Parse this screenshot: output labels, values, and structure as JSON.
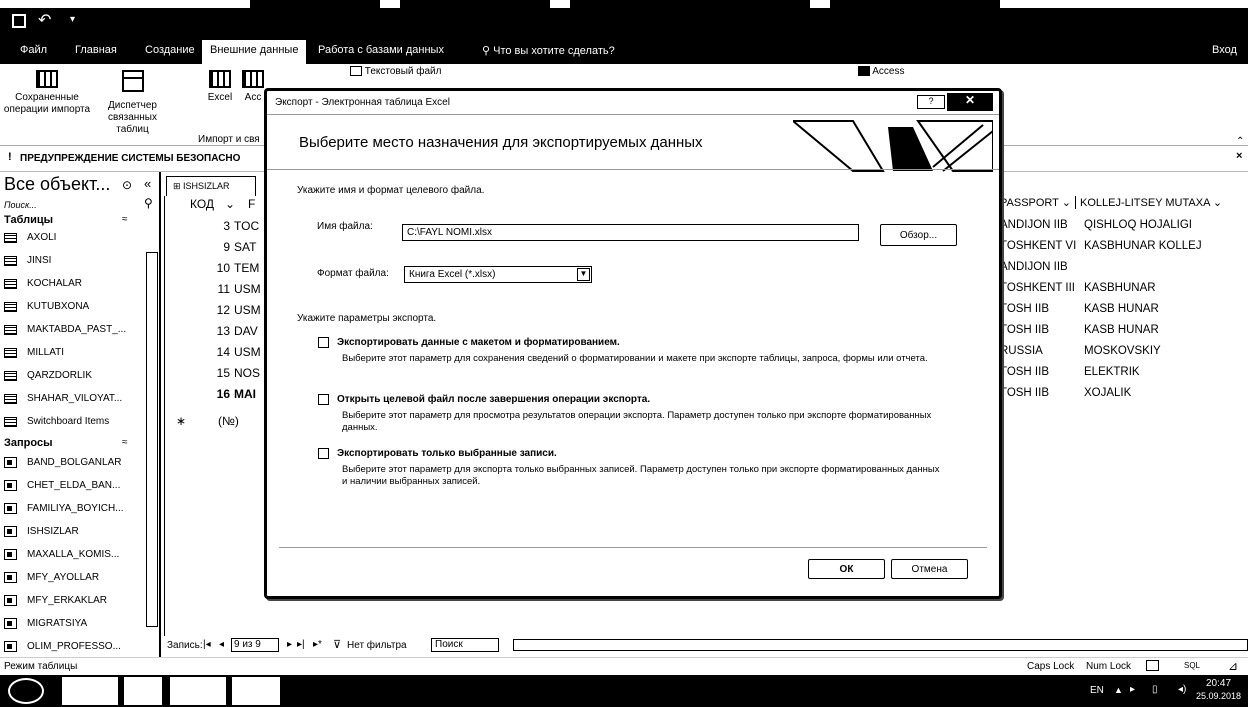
{
  "titlebar": {
    "save_icon": "save-icon",
    "undo_icon": "undo-icon"
  },
  "tabs": [
    {
      "label": "Файл"
    },
    {
      "label": "Главная"
    },
    {
      "label": "Создание"
    },
    {
      "label": "Внешние данные"
    },
    {
      "label": "Работа с базами данных"
    },
    {
      "label": "Что вы хотите сделать?"
    },
    {
      "label": "Вход"
    }
  ],
  "ribbon": {
    "saved_ops": "Сохраненные операции импорта",
    "linked_mgr": "Диспетчер связанных таблиц",
    "excel": "Excel",
    "access_short": "Acc",
    "text_file": "Текстовый файл",
    "access": "Access",
    "group_import": "Импорт и свя"
  },
  "security": {
    "label": "ПРЕДУПРЕЖДЕНИЕ СИСТЕМЫ БЕЗОПАСНО"
  },
  "nav": {
    "title": "Все объект...",
    "search": "Поиск...",
    "tables_hdr": "Таблицы",
    "tables": [
      "AXOLI",
      "JINSI",
      "KOCHALAR",
      "KUTUBXONA",
      "MAKTABDA_PAST_...",
      "MILLATI",
      "QARZDORLIK",
      "SHAHAR_VILOYAT...",
      "Switchboard Items"
    ],
    "queries_hdr": "Запросы",
    "queries": [
      "BAND_BOLGANLAR",
      "CHET_ELDA_BAN...",
      "FAMILIYA_BOYICH...",
      "ISHSIZLAR",
      "MAXALLA_KOMIS...",
      "MFY_AYOLLAR",
      "MFY_ERKAKLAR",
      "MIGRATSIYA",
      "OLIM_PROFESSO..."
    ]
  },
  "table": {
    "tab_name": "ISHSIZLAR",
    "col_kod": "КОД",
    "col_f": "F",
    "rows": [
      {
        "kod": "3",
        "f": "TOC"
      },
      {
        "kod": "9",
        "f": "SAT"
      },
      {
        "kod": "10",
        "f": "TEM"
      },
      {
        "kod": "11",
        "f": "USM"
      },
      {
        "kod": "12",
        "f": "USM"
      },
      {
        "kod": "13",
        "f": "DAV"
      },
      {
        "kod": "14",
        "f": "USM"
      },
      {
        "kod": "15",
        "f": "NOS"
      },
      {
        "kod": "16",
        "f": "MAI"
      }
    ],
    "new_row": "(№)",
    "col_passport": "PASSPORT",
    "col_kollej": "KOLLEJ-LITSEY MUTAXA",
    "right_rows": [
      {
        "passport": "ANDIJON IIB",
        "kollej": "QISHLOQ HOJALIGI"
      },
      {
        "passport": "TOSHKENT VI",
        "kollej": "KASBHUNAR KOLLEJ"
      },
      {
        "passport": "ANDIJON IIB",
        "kollej": ""
      },
      {
        "passport": "TOSHKENT III",
        "kollej": "KASBHUNAR"
      },
      {
        "passport": "TOSH IIB",
        "kollej": "KASB HUNAR"
      },
      {
        "passport": "TOSH IIB",
        "kollej": "KASB HUNAR"
      },
      {
        "passport": "RUSSIA",
        "kollej": "MOSKOVSKIY"
      },
      {
        "passport": "TOSH IIB",
        "kollej": "ELEKTRIK"
      },
      {
        "passport": "TOSH IIB",
        "kollej": "XOJALIK"
      }
    ]
  },
  "recnav": {
    "label": "Запись:",
    "pos": "9 из 9",
    "filter": "Нет фильтра",
    "search": "Поиск"
  },
  "status": {
    "mode": "Режим таблицы",
    "caps": "Caps Lock",
    "num": "Num Lock"
  },
  "taskbar": {
    "lang": "EN",
    "time": "20:47",
    "date": "25.09.2018"
  },
  "dialog": {
    "title": "Экспорт - Электронная таблица Excel",
    "heading": "Выберите место назначения для экспортируемых данных",
    "intro": "Укажите имя и формат целевого файла.",
    "filename_label": "Имя файла:",
    "filename_value": "C:\\FAYL NOMI.xlsx",
    "browse": "Обзор...",
    "format_label": "Формат файла:",
    "format_value": "Книга Excel (*.xlsx)",
    "params": "Укажите параметры экспорта.",
    "opt1": "Экспортировать данные с макетом и форматированием.",
    "opt1_desc": "Выберите этот параметр для сохранения сведений о форматировании и макете при экспорте таблицы, запроса, формы или отчета.",
    "opt2": "Открыть целевой файл после завершения операции экспорта.",
    "opt2_desc": "Выберите этот параметр для просмотра результатов операции экспорта. Параметр доступен только при экспорте форматированных данных.",
    "opt3": "Экспортировать только выбранные записи.",
    "opt3_desc": "Выберите этот параметр для экспорта только выбранных записей. Параметр доступен только при экспорте форматированных данных и наличии выбранных записей.",
    "ok": "ОК",
    "cancel": "Отмена"
  }
}
